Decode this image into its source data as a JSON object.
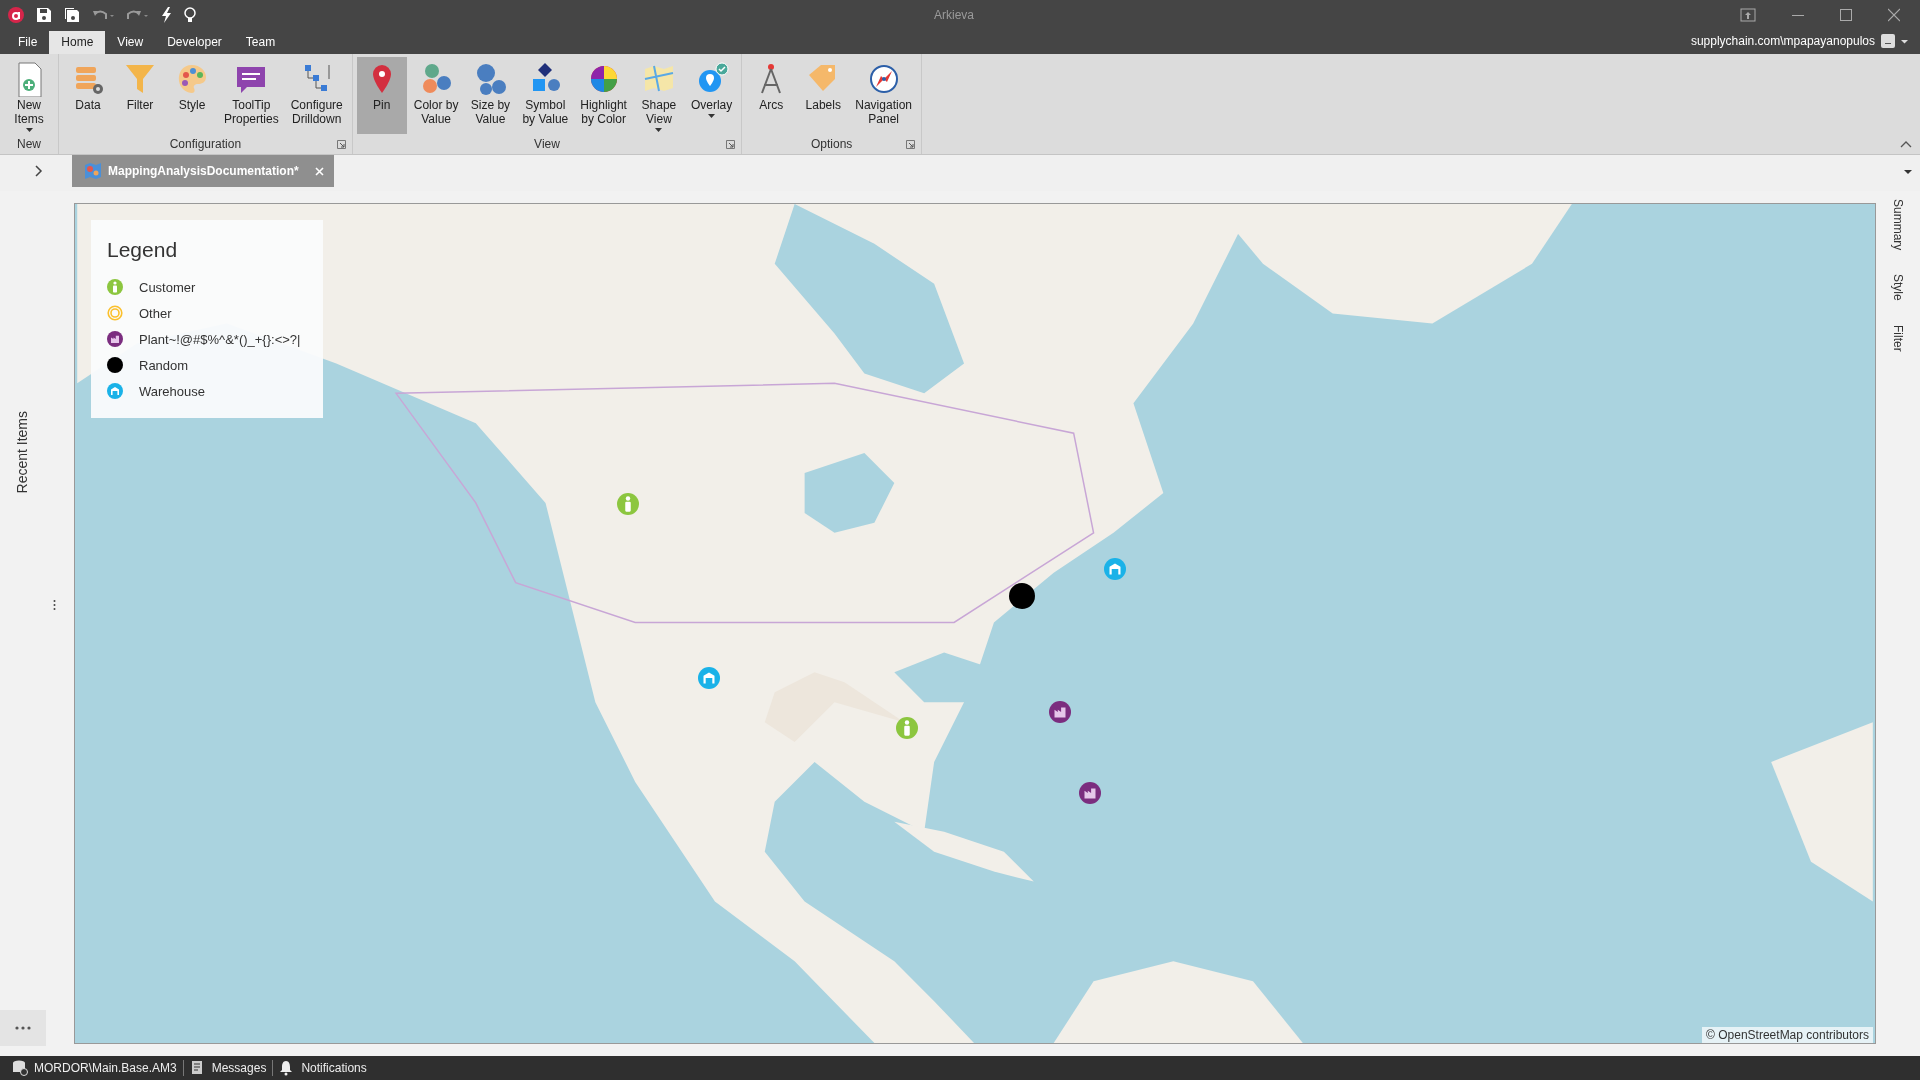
{
  "window": {
    "title": "Arkieva",
    "user": "supplychain.com\\mpapayanopulos"
  },
  "menu_tabs": [
    {
      "label": "File",
      "selected": false
    },
    {
      "label": "Home",
      "selected": true
    },
    {
      "label": "View",
      "selected": false
    },
    {
      "label": "Developer",
      "selected": false
    },
    {
      "label": "Team",
      "selected": false
    }
  ],
  "ribbon_groups": [
    {
      "label": "New",
      "launcher": false,
      "buttons": [
        {
          "label": "New\nItems",
          "dropdown": true,
          "selected": false
        }
      ]
    },
    {
      "label": "Configuration",
      "launcher": true,
      "buttons": [
        {
          "label": "Data",
          "dropdown": false,
          "selected": false
        },
        {
          "label": "Filter",
          "dropdown": false,
          "selected": false
        },
        {
          "label": "Style",
          "dropdown": false,
          "selected": false
        },
        {
          "label": "ToolTip\nProperties",
          "dropdown": false,
          "selected": false
        },
        {
          "label": "Configure\nDrilldown",
          "dropdown": false,
          "selected": false
        }
      ]
    },
    {
      "label": "View",
      "launcher": true,
      "buttons": [
        {
          "label": "Pin",
          "dropdown": false,
          "selected": true
        },
        {
          "label": "Color by\nValue",
          "dropdown": false,
          "selected": false
        },
        {
          "label": "Size by\nValue",
          "dropdown": false,
          "selected": false
        },
        {
          "label": "Symbol\nby Value",
          "dropdown": false,
          "selected": false
        },
        {
          "label": "Highlight\nby Color",
          "dropdown": false,
          "selected": false
        },
        {
          "label": "Shape\nView",
          "dropdown": true,
          "selected": false
        },
        {
          "label": "Overlay",
          "dropdown": true,
          "selected": false
        }
      ]
    },
    {
      "label": "Options",
      "launcher": true,
      "buttons": [
        {
          "label": "Arcs",
          "dropdown": false,
          "selected": false
        },
        {
          "label": "Labels",
          "dropdown": false,
          "selected": false
        },
        {
          "label": "Navigation\nPanel",
          "dropdown": false,
          "selected": false
        }
      ]
    }
  ],
  "document_tab": {
    "title": "MappingAnalysisDocumentation*"
  },
  "left_panel": {
    "label": "Recent Items"
  },
  "right_panel": {
    "tabs": [
      "Summary",
      "Style",
      "Filter"
    ]
  },
  "map": {
    "kind": "picture",
    "attribution": "© OpenStreetMap contributors",
    "legend": {
      "title": "Legend",
      "items": [
        {
          "label": "Customer",
          "kind": "customer"
        },
        {
          "label": "Other",
          "kind": "other"
        },
        {
          "label": "Plant~!@#$%^&*()_+{}:<>?|",
          "kind": "plant"
        },
        {
          "label": "Random",
          "kind": "random"
        },
        {
          "label": "Warehouse",
          "kind": "warehouse"
        }
      ]
    },
    "pins": [
      {
        "kind": "customer"
      },
      {
        "kind": "random"
      },
      {
        "kind": "warehouse"
      },
      {
        "kind": "warehouse"
      },
      {
        "kind": "customer"
      },
      {
        "kind": "plant"
      },
      {
        "kind": "plant"
      }
    ]
  },
  "status_bar": [
    {
      "label": "MORDOR\\Main.Base.AM3",
      "kind": "database"
    },
    {
      "label": "Messages",
      "kind": "messages"
    },
    {
      "label": "Notifications",
      "kind": "notifications"
    }
  ]
}
